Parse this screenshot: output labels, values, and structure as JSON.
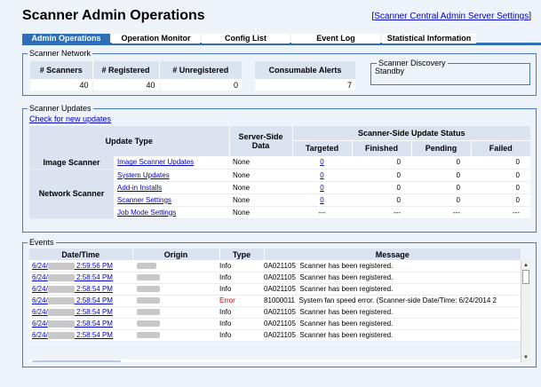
{
  "header": {
    "title": "Scanner Admin Operations",
    "server_link_open": "[",
    "server_link": "Scanner Central Admin Server Settings",
    "server_link_close": "]"
  },
  "tabs": [
    {
      "label": "Admin Operations",
      "active": true
    },
    {
      "label": "Operation Monitor"
    },
    {
      "label": "Config List"
    },
    {
      "label": "Event Log"
    },
    {
      "label": "Statistical Information"
    }
  ],
  "network": {
    "legend": "Scanner Network",
    "headers": [
      "# Scanners",
      "# Registered",
      "# Unregistered",
      "Consumable Alerts"
    ],
    "values": [
      "40",
      "40",
      "0",
      "7"
    ],
    "discovery_legend": "Scanner Discovery",
    "discovery_status": "Standby"
  },
  "updates": {
    "legend": "Scanner Updates",
    "check_link": "Check for new updates",
    "headers": {
      "update_type": "Update Type",
      "server_side": "Server-Side Data",
      "scanner_side": "Scanner-Side Update Status",
      "targeted": "Targeted",
      "finished": "Finished",
      "pending": "Pending",
      "failed": "Failed"
    },
    "groups": {
      "image": "Image Scanner",
      "network": "Network Scanner"
    },
    "rows": [
      {
        "name": "Image Scanner Updates",
        "server": "None",
        "targeted": "0",
        "finished": "0",
        "pending": "0",
        "failed": "0"
      },
      {
        "name": "System Updates",
        "server": "None",
        "targeted": "0",
        "finished": "0",
        "pending": "0",
        "failed": "0"
      },
      {
        "name": "Add-in Installs",
        "server": "None",
        "targeted": "0",
        "finished": "0",
        "pending": "0",
        "failed": "0"
      },
      {
        "name": "Scanner Settings",
        "server": "None",
        "targeted": "0",
        "finished": "0",
        "pending": "0",
        "failed": "0"
      },
      {
        "name": "Job Mode Settings",
        "server": "None",
        "targeted": "---",
        "finished": "---",
        "pending": "---",
        "failed": "---"
      }
    ]
  },
  "events": {
    "legend": "Events",
    "headers": [
      "Date/Time",
      "Origin",
      "Type",
      "Message"
    ],
    "rows": [
      {
        "date_prefix": "6/24/",
        "time": "2:59:56 PM",
        "type": "Info",
        "code": "0A021105",
        "message": "Scanner has been registered."
      },
      {
        "date_prefix": "6/24/",
        "time": "2:58:54 PM",
        "type": "Info",
        "code": "0A021105",
        "message": "Scanner has been registered."
      },
      {
        "date_prefix": "6/24/",
        "time": "2:58:54 PM",
        "type": "Info",
        "code": "0A021105",
        "message": "Scanner has been registered."
      },
      {
        "date_prefix": "6/24/",
        "time": "2:58:54 PM",
        "type": "Error",
        "code": "81000011",
        "message": "System fan speed error. (Scanner-side Date/Time: 6/24/2014 2"
      },
      {
        "date_prefix": "6/24/",
        "time": "2:58:54 PM",
        "type": "Info",
        "code": "0A021105",
        "message": "Scanner has been registered."
      },
      {
        "date_prefix": "6/24/",
        "time": "2:58:54 PM",
        "type": "Info",
        "code": "0A021105",
        "message": "Scanner has been registered."
      },
      {
        "date_prefix": "6/24/",
        "time": "2:58:54 PM",
        "type": "Info",
        "code": "0A021105",
        "message": "Scanner has been registered."
      }
    ]
  }
}
